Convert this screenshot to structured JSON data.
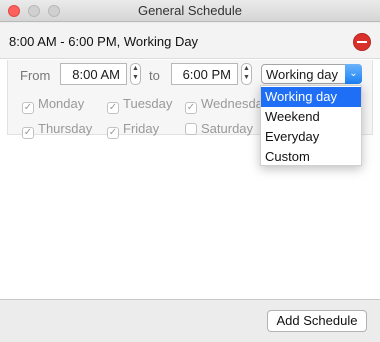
{
  "window": {
    "title": "General Schedule"
  },
  "schedule": {
    "summary": "8:00 AM - 6:00 PM, Working Day",
    "from_label": "From",
    "from_value": "8:00 AM",
    "to_label": "to",
    "to_value": "6:00 PM",
    "preset_value": "Working day",
    "days": [
      {
        "label": "Monday",
        "checked": true
      },
      {
        "label": "Tuesday",
        "checked": true
      },
      {
        "label": "Wednesday",
        "checked": true
      },
      {
        "label": "Thursday",
        "checked": true
      },
      {
        "label": "Friday",
        "checked": true
      },
      {
        "label": "Saturday",
        "checked": false
      }
    ]
  },
  "dropdown": {
    "options": [
      "Working day",
      "Weekend",
      "Everyday",
      "Custom"
    ],
    "selected": "Working day"
  },
  "footer": {
    "add_label": "Add Schedule"
  },
  "colors": {
    "accent": "#1e6ff5",
    "remove": "#d9302b",
    "close": "#fc615d"
  },
  "icons": {
    "stepper": "up-down-arrows",
    "remove": "minus-circle",
    "select_arrow": "chevron-down"
  }
}
